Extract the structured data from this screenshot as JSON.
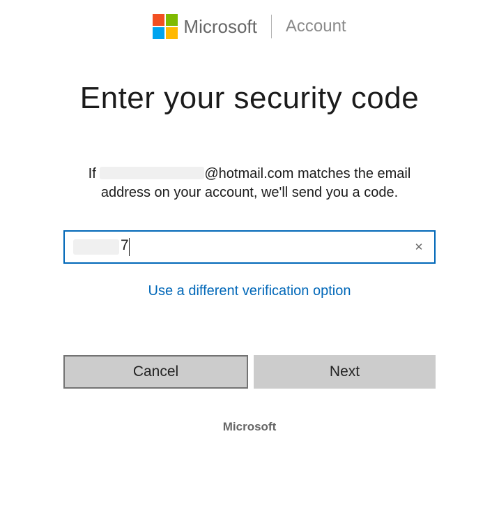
{
  "header": {
    "brand_text": "Microsoft",
    "section_text": "Account"
  },
  "main": {
    "title": "Enter your security code",
    "instruction_prefix": "If ",
    "instruction_email_domain": "@hotmail.com",
    "instruction_suffix": " matches the email address on your account, we'll send you a code.",
    "input_value_visible": "7",
    "alt_option_link": "Use a different verification option",
    "cancel_label": "Cancel",
    "next_label": "Next"
  },
  "footer": {
    "brand": "Microsoft"
  },
  "icons": {
    "clear_x": "✕"
  }
}
